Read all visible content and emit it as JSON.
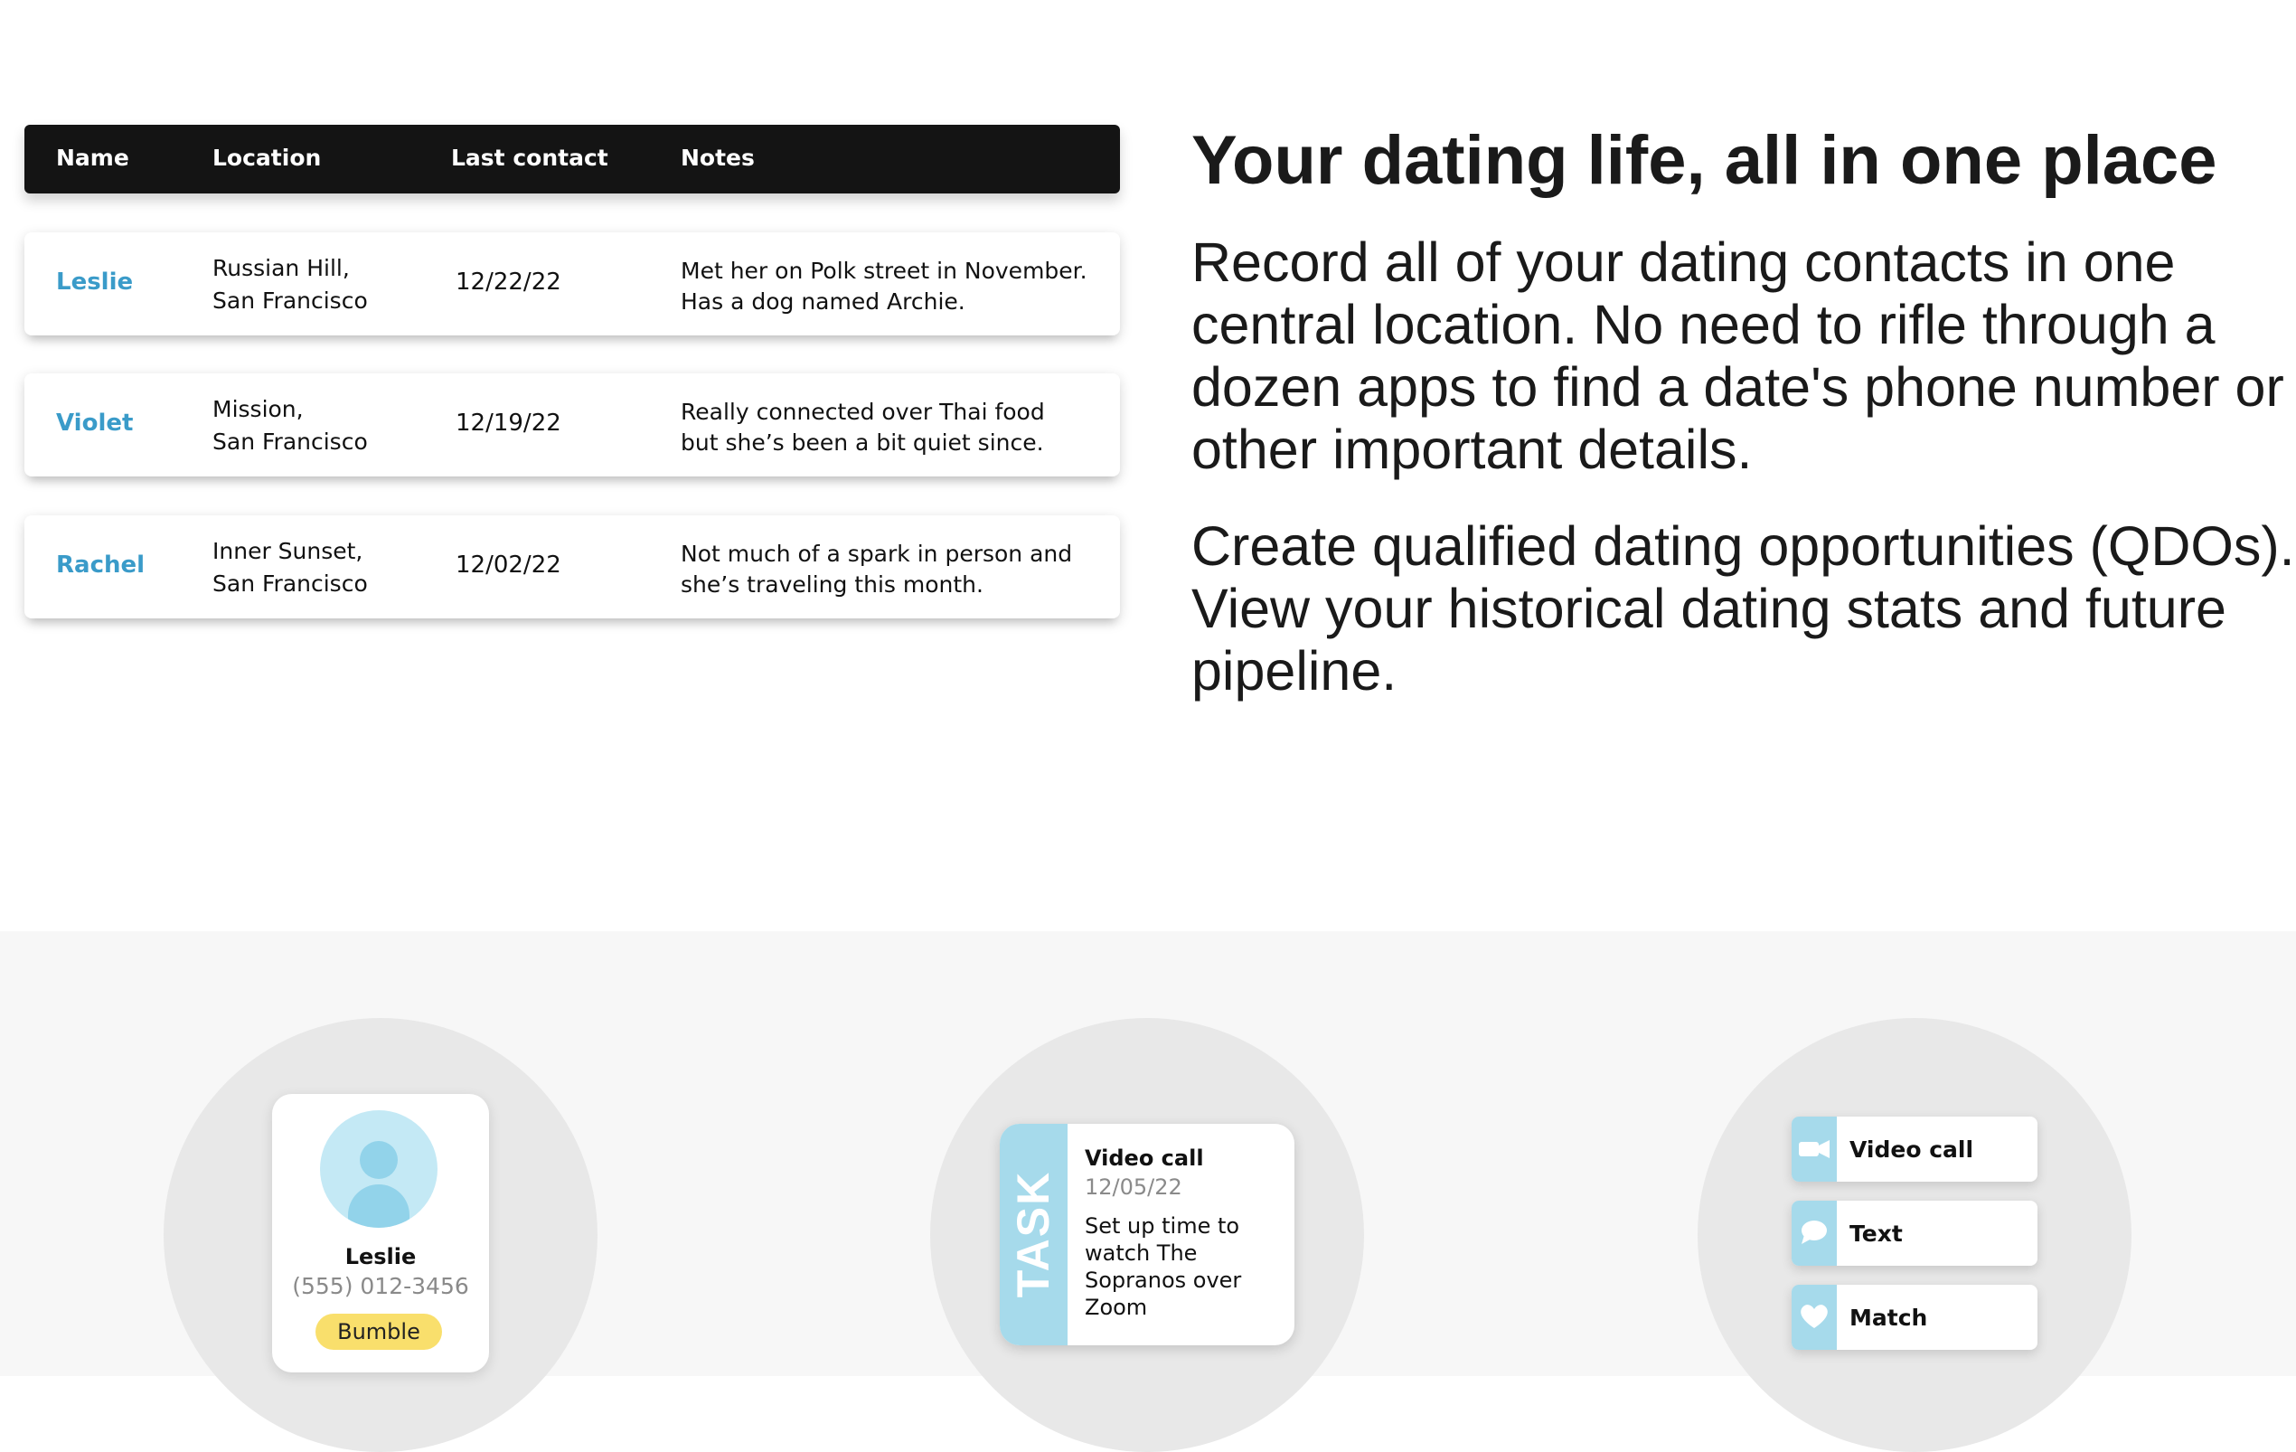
{
  "table": {
    "headers": [
      "Name",
      "Location",
      "Last contact",
      "Notes"
    ],
    "rows": [
      {
        "name": "Leslie",
        "location": [
          "Russian Hill,",
          "San Francisco"
        ],
        "last_contact": "12/22/22",
        "notes": [
          "Met her on Polk street in November.",
          "Has a dog named Archie."
        ]
      },
      {
        "name": "Violet",
        "location": [
          "Mission,",
          "San Francisco"
        ],
        "last_contact": "12/19/22",
        "notes": [
          "Really connected over Thai food",
          "but she’s been a bit quiet since."
        ]
      },
      {
        "name": "Rachel",
        "location": [
          "Inner Sunset,",
          "San Francisco"
        ],
        "last_contact": "12/02/22",
        "notes": [
          "Not much of a spark in person and",
          "she’s traveling this month."
        ]
      }
    ]
  },
  "hero": {
    "title": "Your dating life, all in one place",
    "paragraph1": [
      "Record all of your dating contacts in one",
      "central location. No need to rifle through a",
      "dozen apps to find a date's phone number or",
      "other important details."
    ],
    "paragraph2": [
      "Create qualified dating opportunities (QDOs).",
      "View your historical dating stats and future",
      "pipeline."
    ]
  },
  "contact_card": {
    "name": "Leslie",
    "phone": "(555) 012-3456",
    "app": "Bumble"
  },
  "task_card": {
    "tag": "TASK",
    "title": "Video call",
    "date": "12/05/22",
    "body": [
      "Set up time to",
      "watch The",
      "Sopranos over",
      "Zoom"
    ]
  },
  "actions": [
    {
      "label": "Video call",
      "icon": "video-camera-icon"
    },
    {
      "label": "Text",
      "icon": "chat-bubble-icon"
    },
    {
      "label": "Match",
      "icon": "heart-icon"
    }
  ],
  "colors": {
    "name_link": "#3a9bc9",
    "accent_blue": "#a6daeb",
    "badge_yellow": "#f9df6c",
    "header_bg": "#141414"
  }
}
